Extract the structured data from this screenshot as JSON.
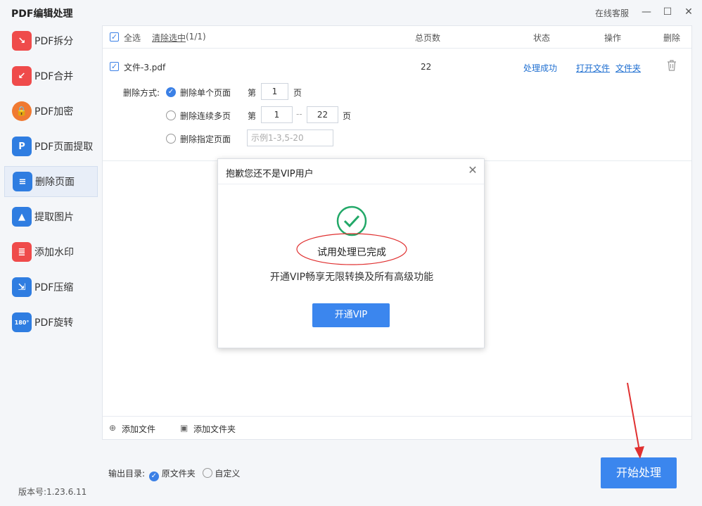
{
  "app": {
    "title": "PDF编辑处理",
    "online_service": "在线客服",
    "version": "版本号:1.23.6.11"
  },
  "sidebar": {
    "items": [
      {
        "label": "PDF拆分",
        "icon": "split-icon",
        "color": "#ef4b4b"
      },
      {
        "label": "PDF合并",
        "icon": "merge-icon",
        "color": "#ef4b4b"
      },
      {
        "label": "PDF加密",
        "icon": "lock-icon",
        "color": "#f07a32"
      },
      {
        "label": "PDF页面提取",
        "icon": "extract-page-icon",
        "color": "#2f7de1"
      },
      {
        "label": "删除页面",
        "icon": "delete-page-icon",
        "color": "#2f7de1"
      },
      {
        "label": "提取图片",
        "icon": "image-extract-icon",
        "color": "#2f7de1"
      },
      {
        "label": "添加水印",
        "icon": "watermark-icon",
        "color": "#ef4b4b"
      },
      {
        "label": "PDF压缩",
        "icon": "compress-icon",
        "color": "#2f7de1"
      },
      {
        "label": "PDF旋转",
        "icon": "rotate-icon",
        "color": "#2f7de1"
      }
    ]
  },
  "table": {
    "select_all": "全选",
    "clear_selection": "清除选中",
    "selection_count": "(1/1)",
    "col_pages": "总页数",
    "col_status": "状态",
    "col_action": "操作",
    "col_delete": "删除"
  },
  "file": {
    "name": "文件-3.pdf",
    "pages": "22",
    "status": "处理成功",
    "open_file": "打开文件",
    "open_folder": "文件夹"
  },
  "delete_mode": {
    "label": "删除方式:",
    "single": "删除单个页面",
    "range": "删除连续多页",
    "specific": "删除指定页面",
    "page_prefix": "第",
    "page_suffix": "页",
    "single_value": "1",
    "range_from": "1",
    "range_sep": "--",
    "range_to": "22",
    "specific_placeholder": "示例1-3,5-20"
  },
  "footer": {
    "add_file": "添加文件",
    "add_folder": "添加文件夹"
  },
  "output": {
    "label": "输出目录:",
    "original": "原文件夹",
    "custom": "自定义"
  },
  "start_button": "开始处理",
  "dialog": {
    "title": "抱歉您还不是VIP用户",
    "done": "试用处理已完成",
    "message": "开通VIP畅享无限转换及所有高级功能",
    "button": "开通VIP"
  },
  "colors": {
    "accent": "#3b86ee",
    "link": "#1f6fd1",
    "success": "#22a868",
    "annotation": "#e03030"
  }
}
